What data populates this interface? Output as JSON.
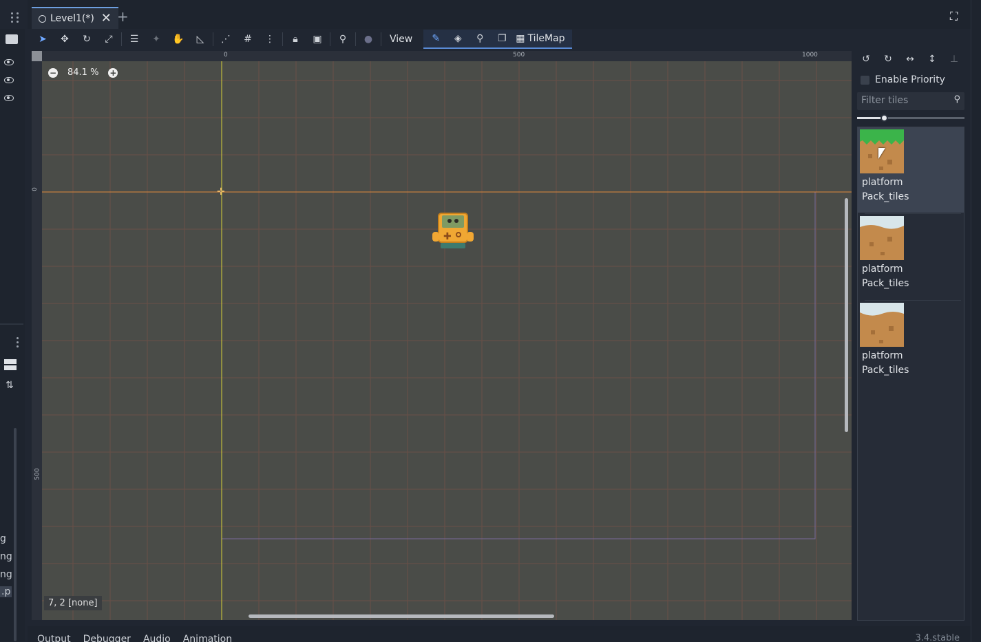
{
  "editor": {
    "tab": {
      "label": "Level1(*)"
    },
    "toolbar": {
      "view_label": "View",
      "tilemap_label": "TileMap"
    },
    "viewport": {
      "zoom": "84.1 %",
      "status": "7, 2 [none]",
      "ruler_top": [
        "0",
        "500",
        "1000"
      ],
      "ruler_left": [
        "0",
        "500"
      ]
    },
    "tile_panel": {
      "enable_priority_label": "Enable Priority",
      "filter_placeholder": "Filter tiles",
      "tiles": [
        {
          "line1": "platform",
          "line2": "Pack_tiles",
          "selected": true,
          "top_color": "#3bb44a"
        },
        {
          "line1": "platform",
          "line2": "Pack_tiles",
          "selected": false,
          "top_color": "#d8e6ea"
        },
        {
          "line1": "platform",
          "line2": "Pack_tiles",
          "selected": false,
          "top_color": "#d8e6ea"
        }
      ]
    },
    "left_dock": {
      "partial_labels": [
        "g",
        "ng",
        "ng",
        ".p"
      ]
    },
    "bottom_panel": {
      "tabs": [
        "Output",
        "Debugger",
        "Audio",
        "Animation"
      ],
      "version": "3.4.stable"
    },
    "colors": {
      "accent": "#6fa8ff",
      "viewport_bg": "#4a4c48",
      "grid_line": "#6a4f47",
      "axis_x": "#e08a3c",
      "axis_y": "#d8d23a"
    }
  }
}
